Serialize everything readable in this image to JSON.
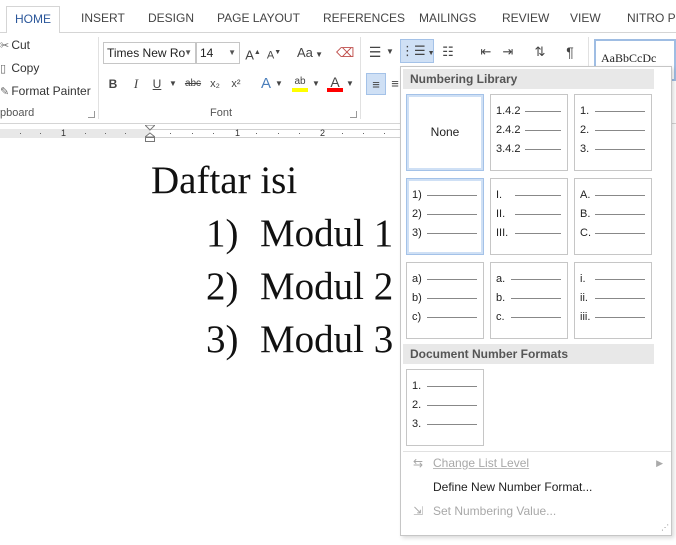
{
  "tabs": [
    "HOME",
    "INSERT",
    "DESIGN",
    "PAGE LAYOUT",
    "REFERENCES",
    "MAILINGS",
    "REVIEW",
    "VIEW",
    "NITRO PR"
  ],
  "active_tab": "HOME",
  "clipboard": {
    "cut_label": "Cut",
    "copy_label": "Copy",
    "format_painter_label": "Format Painter",
    "group_label": "pboard"
  },
  "font": {
    "name_value": "Times New Ro",
    "size_value": "14",
    "group_label": "Font",
    "grow_label": "A",
    "shrink_label": "A",
    "case_label": "Aa",
    "bold": "B",
    "italic": "I",
    "underline": "U",
    "strike": "abc",
    "subscript": "x₂",
    "superscript": "x²",
    "text_effects": "A",
    "highlight": "ab",
    "font_color": "A",
    "highlight_color": "#ffff00",
    "font_color_swatch": "#ff0000"
  },
  "styles": {
    "preview_text": "AaBbCcDc"
  },
  "ruler": {
    "numbers": [
      "1",
      "1",
      "2"
    ]
  },
  "document": {
    "title": "Daftar isi",
    "items": [
      {
        "num": "1)",
        "text": "Modul 1"
      },
      {
        "num": "2)",
        "text": "Modul 2"
      },
      {
        "num": "3)",
        "text": "Modul 3"
      }
    ]
  },
  "numbering_menu": {
    "library_header": "Numbering Library",
    "none_label": "None",
    "tiles": [
      [
        "1.4.2",
        "2.4.2",
        "3.4.2"
      ],
      [
        "1.",
        "2.",
        "3."
      ],
      [
        "1)",
        "2)",
        "3)"
      ],
      [
        "I.",
        "II.",
        "III."
      ],
      [
        "A.",
        "B.",
        "C."
      ],
      [
        "a)",
        "b)",
        "c)"
      ],
      [
        "a.",
        "b.",
        "c."
      ],
      [
        "i.",
        "ii.",
        "iii."
      ]
    ],
    "document_header": "Document Number Formats",
    "document_tiles": [
      [
        "1.",
        "2.",
        "3."
      ]
    ],
    "change_level": "Change List Level",
    "define_new": "Define New Number Format...",
    "set_value": "Set Numbering Value..."
  },
  "colors": {
    "accent": "#2b579a",
    "selected_border": "#a4c2e8",
    "header_bg": "#e8e8e8"
  }
}
